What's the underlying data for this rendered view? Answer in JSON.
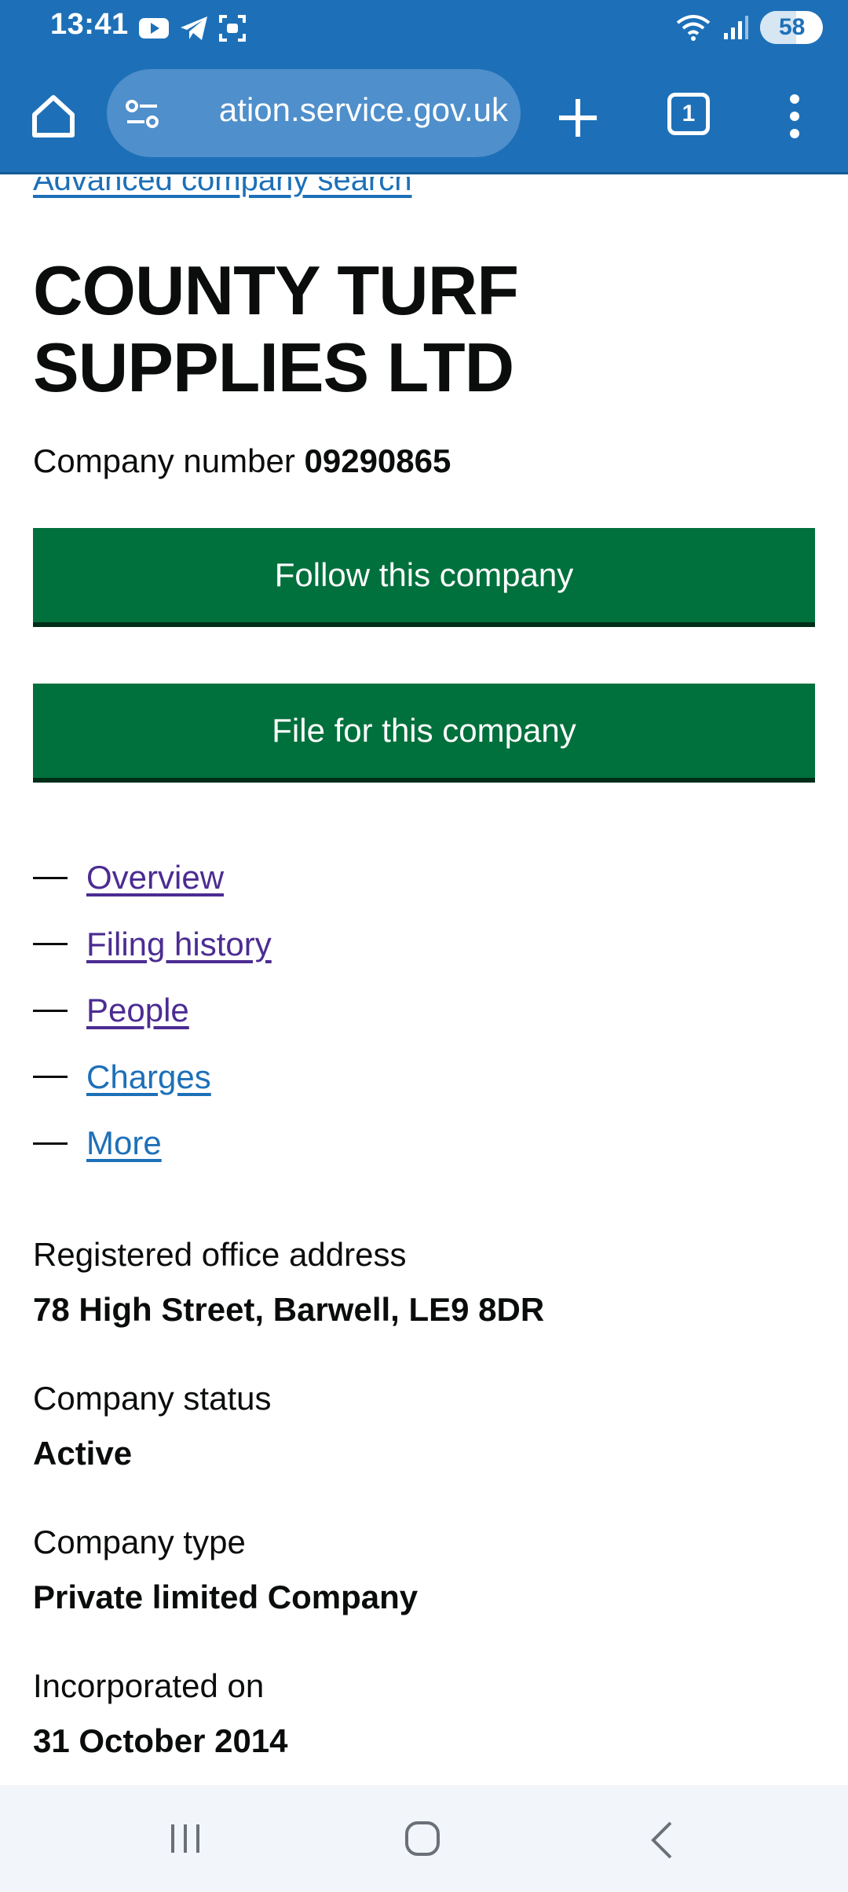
{
  "status_bar": {
    "time": "13:41",
    "battery_level": "58"
  },
  "browser": {
    "url": "ation.service.gov.uk",
    "tab_count": "1"
  },
  "page": {
    "advanced_search_link": "Advanced company search",
    "company_name": "COUNTY TURF SUPPLIES LTD",
    "company_number_label": "Company number",
    "company_number": "09290865",
    "follow_button": "Follow this company",
    "file_button": "File for this company",
    "subnav": [
      {
        "label": "Overview",
        "visited": true
      },
      {
        "label": "Filing history",
        "visited": true
      },
      {
        "label": "People",
        "visited": true
      },
      {
        "label": "Charges",
        "visited": false
      },
      {
        "label": "More",
        "visited": false
      }
    ],
    "details": {
      "address_label": "Registered office address",
      "address_value": "78 High Street, Barwell, LE9 8DR",
      "status_label": "Company status",
      "status_value": "Active",
      "type_label": "Company type",
      "type_value": "Private limited Company",
      "incorporated_label": "Incorporated on",
      "incorporated_value": "31 October 2014"
    }
  },
  "colors": {
    "header_blue": "#1d70b8",
    "button_green": "#00703c",
    "link_visited": "#4c2c92",
    "link_unvisited": "#1d70b8",
    "text": "#0b0c0c"
  }
}
